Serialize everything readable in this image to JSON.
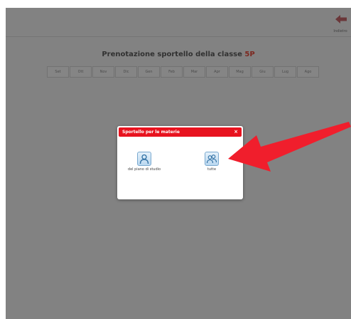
{
  "header": {
    "back_label": "Indietro"
  },
  "page": {
    "title_prefix": "Prenotazione sportello della classe",
    "class_name": "5P"
  },
  "months": [
    "Set",
    "Ott",
    "Nov",
    "Dic",
    "Gen",
    "Feb",
    "Mar",
    "Apr",
    "Mag",
    "Giu",
    "Lug",
    "Ago"
  ],
  "dialog": {
    "title": "Sportello per le materie",
    "close": "×",
    "options": [
      {
        "label": "del piano di studio",
        "icon": "single-person-icon"
      },
      {
        "label": "tutte",
        "icon": "group-people-icon"
      }
    ]
  },
  "colors": {
    "accent_red": "#e8131f",
    "class_color": "#e24a3b",
    "annotation_arrow": "#f01e2c"
  }
}
